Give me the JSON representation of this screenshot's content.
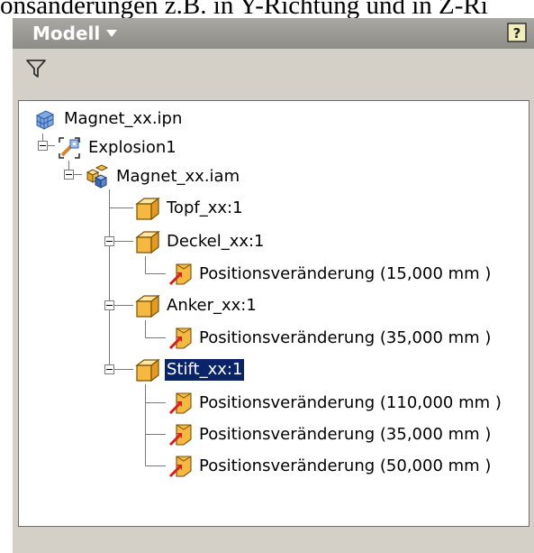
{
  "caption": "onsänderungen z.B. in Y-Richtung und in Z-Ri",
  "panel": {
    "title": "Modell",
    "title_dropdown_icon": "triangle-down-icon",
    "help_icon": "help-icon",
    "filter_icon": "filter-icon"
  },
  "tree": {
    "root": {
      "label": "Magnet_xx.ipn",
      "icon": "presentation-file-icon"
    },
    "explosion": {
      "label": "Explosion1",
      "icon": "explosion-view-icon"
    },
    "assembly": {
      "label": "Magnet_xx.iam",
      "icon": "assembly-icon"
    },
    "parts": [
      {
        "label": "Topf_xx:1",
        "icon": "part-icon",
        "selected": false,
        "tweaks": []
      },
      {
        "label": "Deckel_xx:1",
        "icon": "part-icon",
        "selected": false,
        "tweaks": [
          {
            "label": "Positionsveränderung (15,000 mm )",
            "icon": "tweak-icon"
          }
        ]
      },
      {
        "label": "Anker_xx:1",
        "icon": "part-icon",
        "selected": false,
        "tweaks": [
          {
            "label": "Positionsveränderung (35,000 mm )",
            "icon": "tweak-icon"
          }
        ]
      },
      {
        "label": "Stift_xx:1",
        "icon": "part-icon",
        "selected": true,
        "tweaks": [
          {
            "label": "Positionsveränderung (110,000 mm )",
            "icon": "tweak-icon"
          },
          {
            "label": "Positionsveränderung (35,000 mm )",
            "icon": "tweak-icon"
          },
          {
            "label": "Positionsveränderung (50,000 mm )",
            "icon": "tweak-icon"
          }
        ]
      }
    ]
  },
  "colors": {
    "selection": "#0a246a",
    "panel_bg": "#d4d0c8",
    "titlebar": "#9a9892",
    "part_icon": "#f5b942"
  }
}
